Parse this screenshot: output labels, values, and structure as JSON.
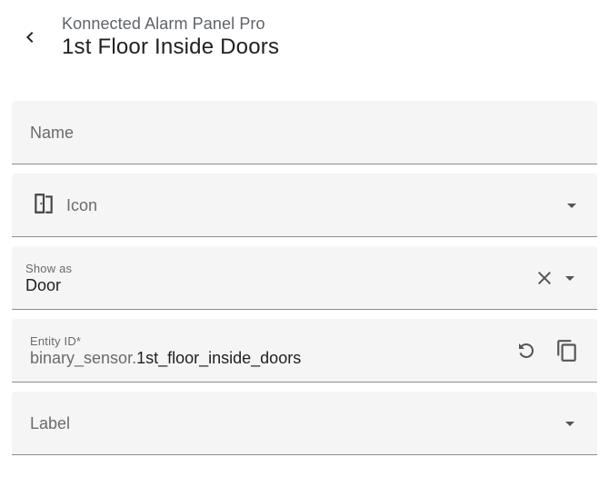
{
  "header": {
    "subtitle": "Konnected Alarm Panel Pro",
    "title": "1st Floor Inside Doors"
  },
  "form": {
    "name": {
      "placeholder": "Name",
      "value": ""
    },
    "icon": {
      "label": "Icon",
      "current_icon": "door-icon"
    },
    "show_as": {
      "label": "Show as",
      "value": "Door"
    },
    "entity_id": {
      "label": "Entity ID*",
      "prefix": "binary_sensor.",
      "value": "1st_floor_inside_doors"
    },
    "label": {
      "placeholder": "Label"
    }
  },
  "colors": {
    "field_background": "#f5f5f5",
    "icon_color": "#444444",
    "text_secondary": "#6b6b6b"
  }
}
